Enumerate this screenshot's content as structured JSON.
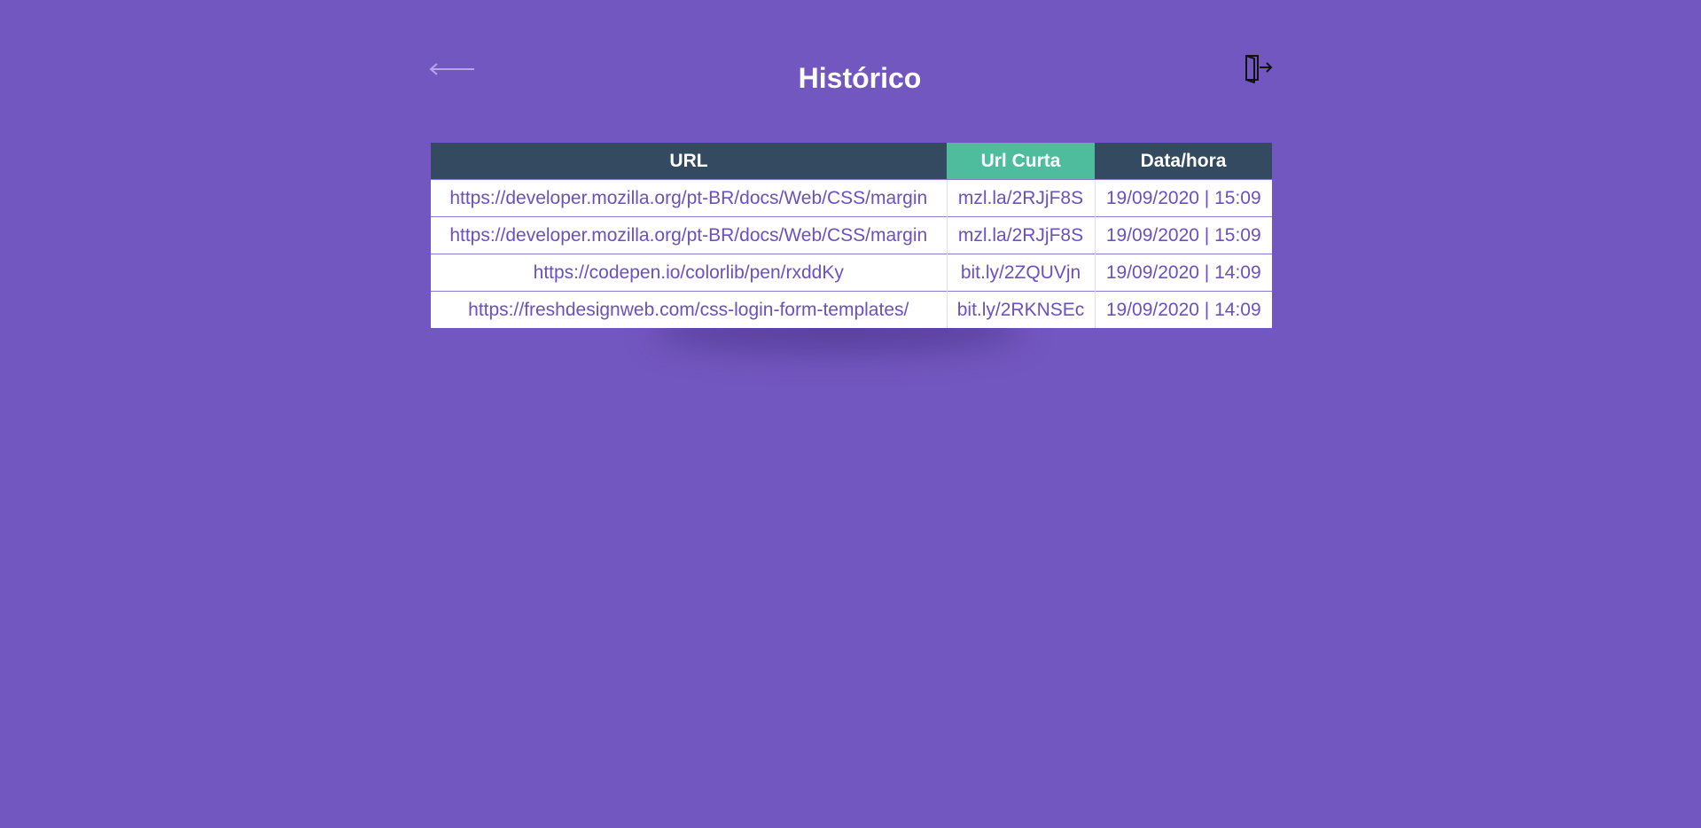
{
  "header": {
    "title": "Histórico",
    "back_icon": "arrow-left-icon",
    "logout_icon": "logout-icon"
  },
  "colors": {
    "background": "#7357c0",
    "table_header": "#334a61",
    "table_header_accent": "#4ebd9e",
    "cell_text": "#6b50bf"
  },
  "table": {
    "columns": [
      "URL",
      "Url Curta",
      "Data/hora"
    ],
    "rows": [
      {
        "url": "https://developer.mozilla.org/pt-BR/docs/Web/CSS/margin",
        "short": "mzl.la/2RJjF8S",
        "datetime": "19/09/2020 | 15:09"
      },
      {
        "url": "https://developer.mozilla.org/pt-BR/docs/Web/CSS/margin",
        "short": "mzl.la/2RJjF8S",
        "datetime": "19/09/2020 | 15:09"
      },
      {
        "url": "https://codepen.io/colorlib/pen/rxddKy",
        "short": "bit.ly/2ZQUVjn",
        "datetime": "19/09/2020 | 14:09"
      },
      {
        "url": "https://freshdesignweb.com/css-login-form-templates/",
        "short": "bit.ly/2RKNSEc",
        "datetime": "19/09/2020 | 14:09"
      }
    ]
  }
}
